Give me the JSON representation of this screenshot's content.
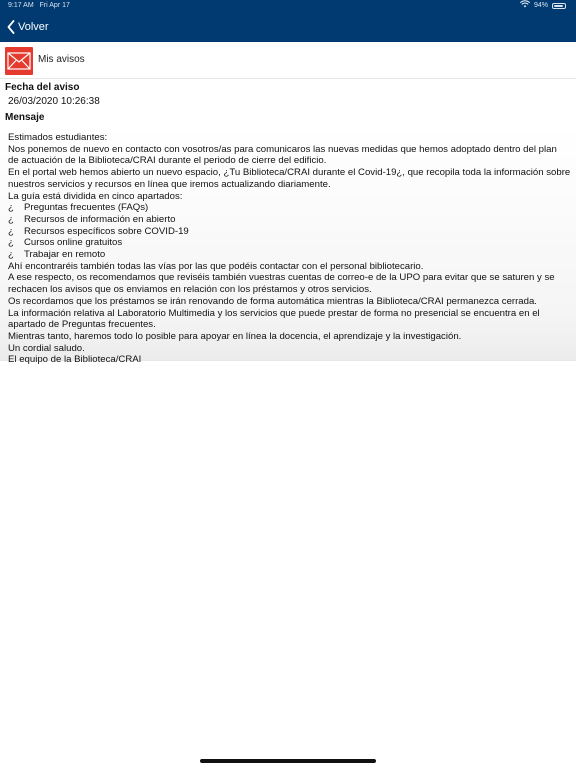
{
  "status_bar": {
    "time": "9:17 AM",
    "date": "Fri Apr 17",
    "battery": "94%",
    "battery_level": 0.94
  },
  "nav": {
    "back_label": "Volver"
  },
  "section": {
    "title": "Mis avisos",
    "icon": "mail-icon"
  },
  "notice": {
    "date_label": "Fecha del aviso",
    "date_value": "26/03/2020 10:26:38",
    "message_label": "Mensaje"
  },
  "message": {
    "lines_top": [
      "Estimados estudiantes:",
      "Nos ponemos de nuevo en contacto con vosotros/as para comunicaros las nuevas medidas que hemos adoptado dentro del plan",
      "de actuación de la Biblioteca/CRAI durante el periodo de cierre del edificio.",
      "En el portal web hemos abierto un nuevo espacio, ¿Tu Biblioteca/CRAI durante el Covid-19¿, que recopila toda la información sobre",
      "nuestros servicios y recursos en línea que iremos actualizando diariamente.",
      "La guía está dividida en cinco apartados:"
    ],
    "bullet_char": "¿",
    "bullets": [
      "Preguntas frecuentes (FAQs)",
      "Recursos de información en abierto",
      "Recursos específicos sobre COVID-19",
      "Cursos online gratuitos",
      "Trabajar en remoto"
    ],
    "lines_bottom": [
      "Ahí encontraréis también todas las vías por las que podéis contactar con el personal bibliotecario.",
      "A ese respecto, os recomendamos que reviséis también vuestras cuentas de correo-e de la UPO para evitar que se saturen y se",
      "rechacen los avisos que os enviamos en relación con los préstamos y otros servicios.",
      "Os recordamos que los préstamos se irán renovando de forma automática mientras la Biblioteca/CRAI permanezca cerrada.",
      "La información relativa al Laboratorio Multimedia y los servicios que puede prestar de forma no presencial se encuentra en el",
      "apartado de Preguntas frecuentes.",
      "Mientras tanto, haremos todo lo posible para apoyar en línea la docencia, el aprendizaje y la investigación.",
      "Un cordial saludo.",
      "El equipo de la Biblioteca/CRAI"
    ]
  }
}
